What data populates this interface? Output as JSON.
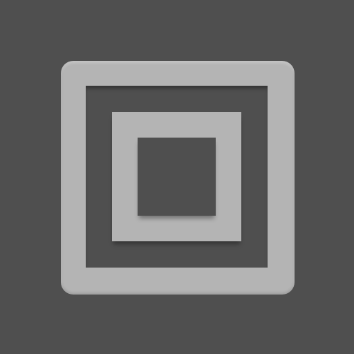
{
  "icon": {
    "name": "nested-squares-icon",
    "colors": {
      "background": "#4f4f4f",
      "frame": "#b4b4b4"
    }
  }
}
